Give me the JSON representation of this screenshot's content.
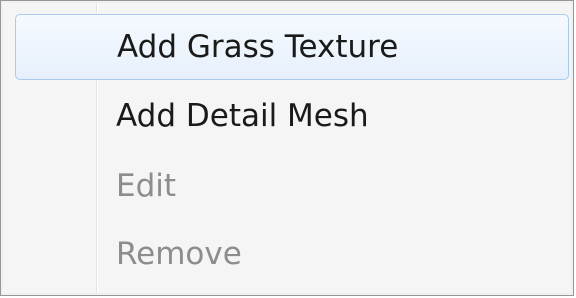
{
  "context_menu": {
    "items": [
      {
        "label": "Add Grass Texture",
        "enabled": true,
        "highlighted": true
      },
      {
        "label": "Add Detail Mesh",
        "enabled": true,
        "highlighted": false
      },
      {
        "label": "Edit",
        "enabled": false,
        "highlighted": false
      },
      {
        "label": "Remove",
        "enabled": false,
        "highlighted": false
      }
    ],
    "colors": {
      "highlight_border": "#a8cbef",
      "highlight_fill": "#e6f0fb",
      "text_enabled": "#1a1a1a",
      "text_disabled": "#8d8d8d",
      "background": "#f0f0f0"
    }
  }
}
